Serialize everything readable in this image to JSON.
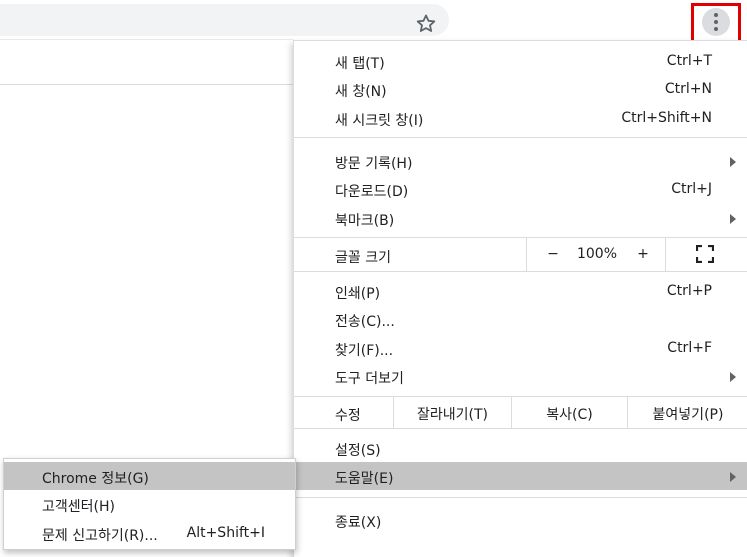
{
  "menu": {
    "new_tab": {
      "label": "새 탭(T)",
      "shortcut": "Ctrl+T"
    },
    "new_window": {
      "label": "새 창(N)",
      "shortcut": "Ctrl+N"
    },
    "new_incognito": {
      "label": "새 시크릿 창(I)",
      "shortcut": "Ctrl+Shift+N"
    },
    "history": {
      "label": "방문 기록(H)"
    },
    "downloads": {
      "label": "다운로드(D)",
      "shortcut": "Ctrl+J"
    },
    "bookmarks": {
      "label": "북마크(B)"
    },
    "zoom": {
      "label": "글꼴 크기",
      "minus": "−",
      "value": "100%",
      "plus": "+"
    },
    "print": {
      "label": "인쇄(P)",
      "shortcut": "Ctrl+P"
    },
    "cast": {
      "label": "전송(C)..."
    },
    "find": {
      "label": "찾기(F)...",
      "shortcut": "Ctrl+F"
    },
    "more_tools": {
      "label": "도구 더보기"
    },
    "edit": {
      "label": "수정",
      "cut": "잘라내기(T)",
      "copy": "복사(C)",
      "paste": "붙여넣기(P)"
    },
    "settings": {
      "label": "설정(S)"
    },
    "help": {
      "label": "도움말(E)"
    },
    "exit": {
      "label": "종료(X)"
    }
  },
  "help_submenu": {
    "about": {
      "label": "Chrome 정보(G)"
    },
    "help_center": {
      "label": "고객센터(H)"
    },
    "report_issue": {
      "label": "문제 신고하기(R)...",
      "shortcut": "Alt+Shift+I"
    }
  },
  "colors": {
    "highlight": "#c4c4c4",
    "callout_border": "#e00000"
  }
}
